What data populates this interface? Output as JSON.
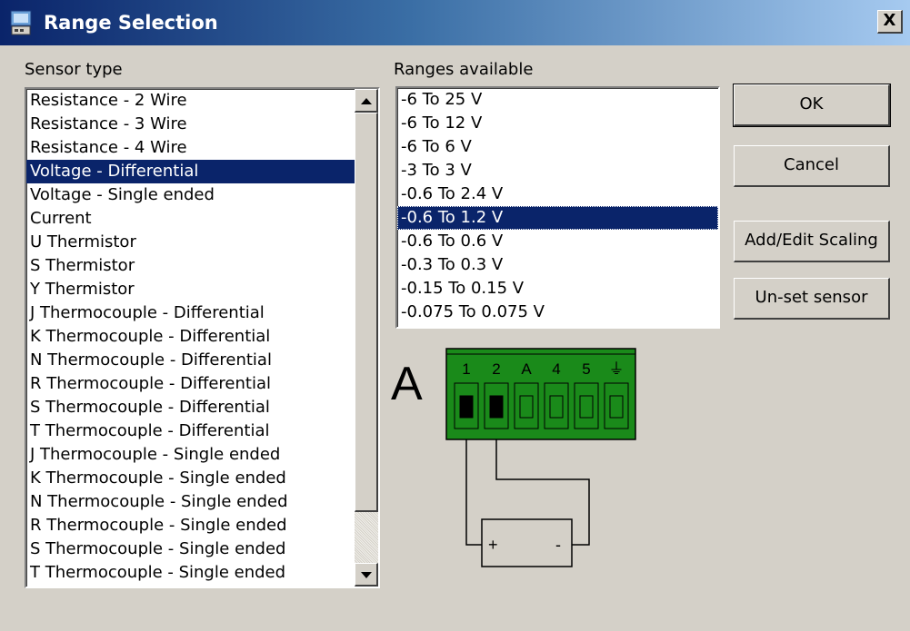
{
  "window": {
    "title": "Range Selection",
    "close_label": "X"
  },
  "sensor_type": {
    "label": "Sensor type",
    "items": [
      "Resistance - 2 Wire",
      "Resistance - 3 Wire",
      "Resistance - 4 Wire",
      "Voltage - Differential",
      "Voltage - Single ended",
      "Current",
      "U  Thermistor",
      "S  Thermistor",
      "Y  Thermistor",
      "J Thermocouple - Differential",
      "K Thermocouple - Differential",
      "N Thermocouple - Differential",
      "R Thermocouple - Differential",
      "S Thermocouple - Differential",
      "T Thermocouple - Differential",
      "J Thermocouple - Single ended",
      "K Thermocouple - Single ended",
      "N Thermocouple - Single ended",
      "R Thermocouple - Single ended",
      "S Thermocouple - Single ended",
      "T Thermocouple - Single ended"
    ],
    "selected_index": 3
  },
  "ranges": {
    "label": "Ranges available",
    "items": [
      "-6 To 25 V",
      "-6 To 12 V",
      "-6 To 6 V",
      "-3 To 3 V",
      "-0.6 To 2.4 V",
      "-0.6 To 1.2 V",
      "-0.6 To 0.6 V",
      "-0.3 To 0.3 V",
      "-0.15 To 0.15 V",
      "-0.075 To 0.075 V"
    ],
    "selected_index": 5
  },
  "buttons": {
    "ok": "OK",
    "cancel": "Cancel",
    "add_edit_scaling": "Add/Edit Scaling",
    "unset_sensor": "Un-set sensor"
  },
  "diagram": {
    "channel_letter": "A",
    "terminal_labels": [
      "1",
      "2",
      "A",
      "4",
      "5",
      "⏚"
    ],
    "connected_terminals": [
      1,
      2
    ],
    "source_plus": "+",
    "source_minus": "-",
    "connector_color": "#1a8a1a"
  },
  "colors": {
    "selection": "#0a246a",
    "face": "#d4d0c8"
  }
}
